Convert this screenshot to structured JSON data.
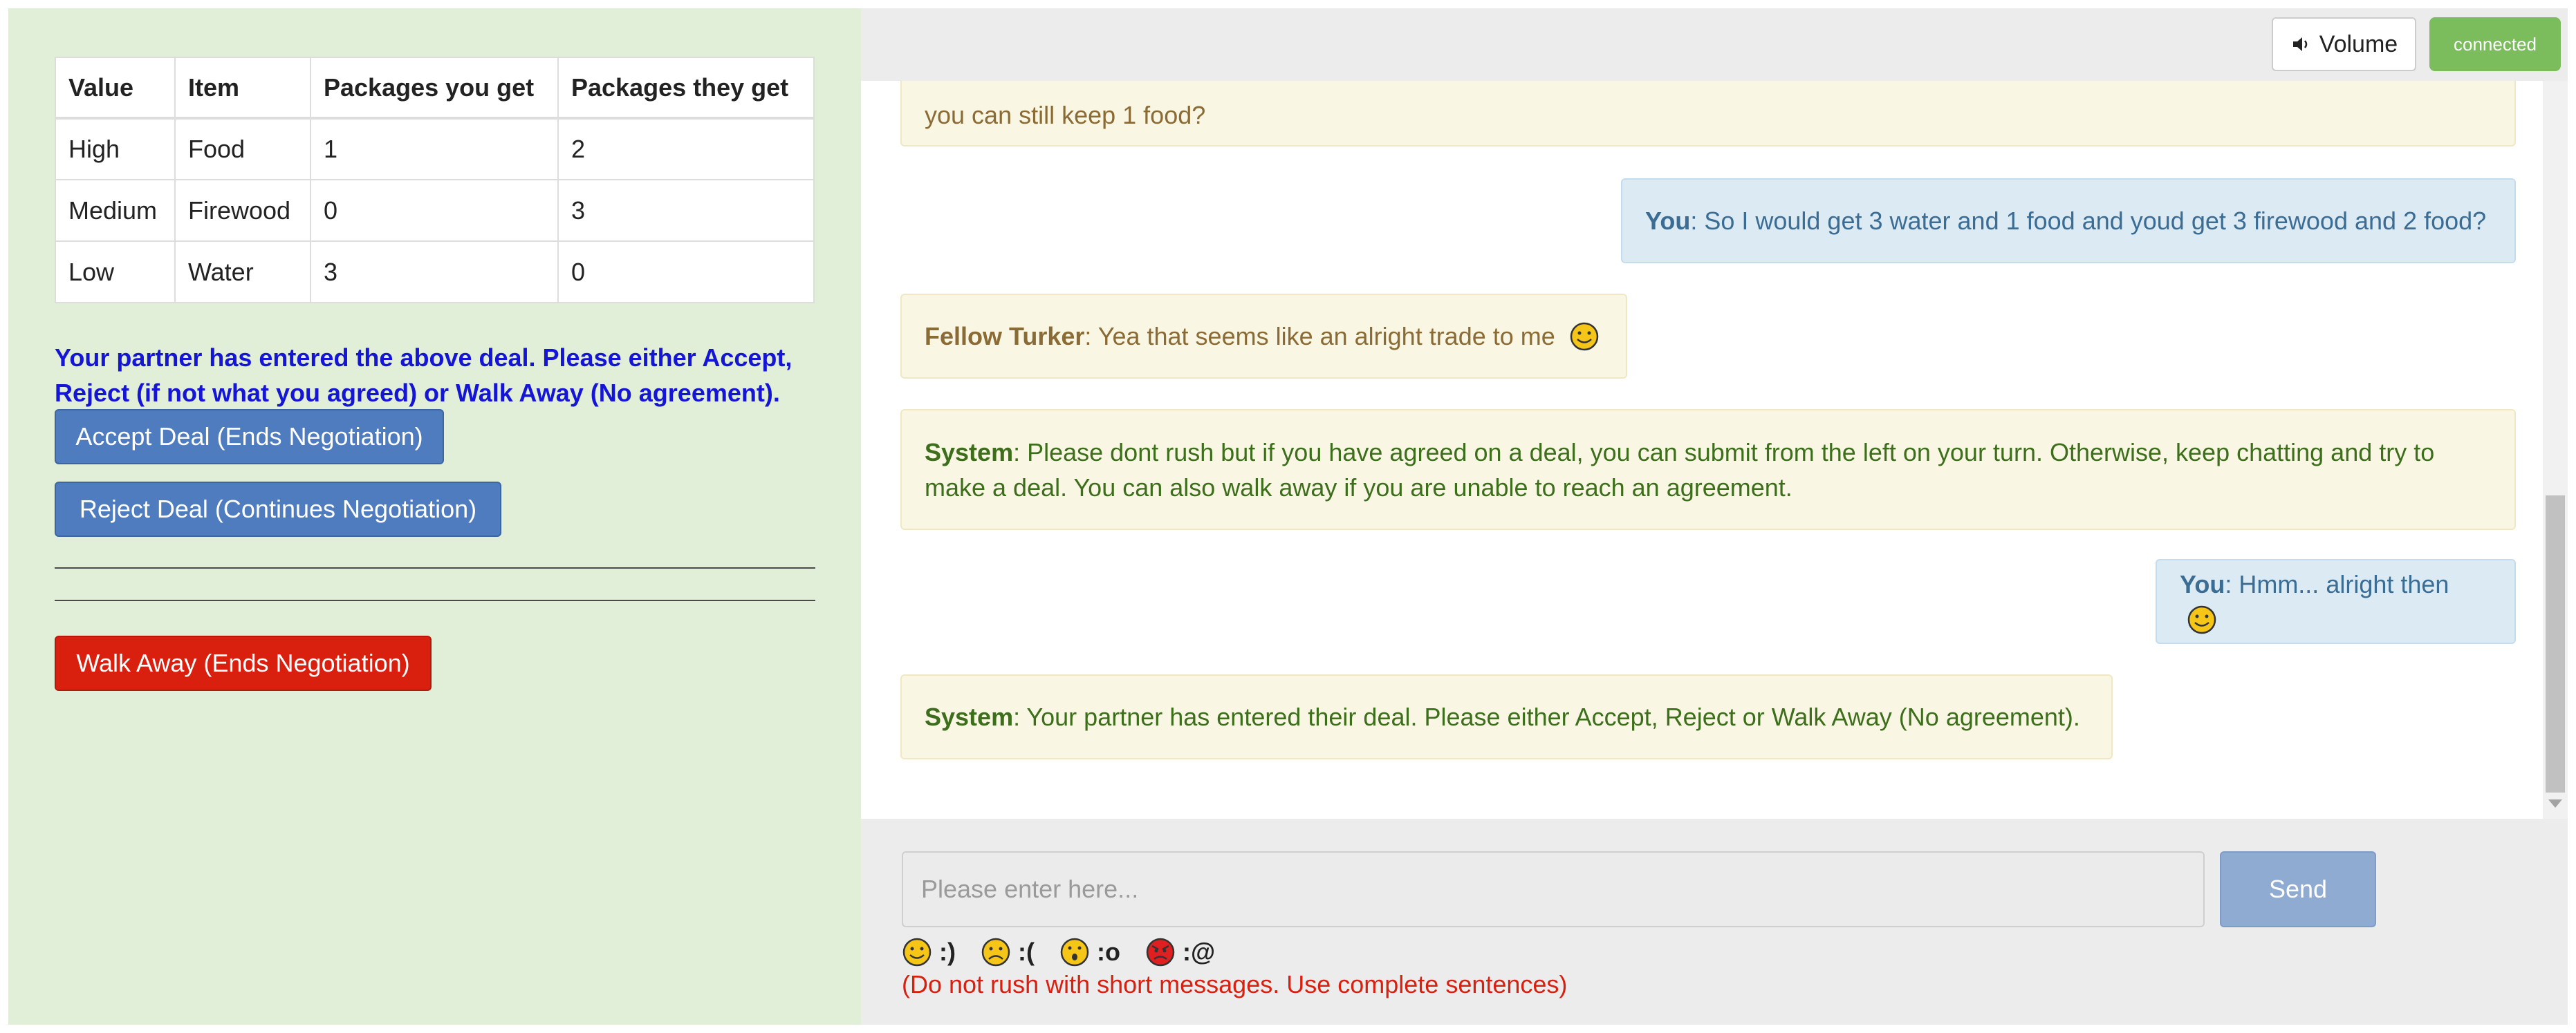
{
  "deal_table": {
    "headers": [
      "Value",
      "Item",
      "Packages you get",
      "Packages they get"
    ],
    "rows": [
      [
        "High",
        "Food",
        "1",
        "2"
      ],
      [
        "Medium",
        "Firewood",
        "0",
        "3"
      ],
      [
        "Low",
        "Water",
        "3",
        "0"
      ]
    ]
  },
  "partner_notice": "Your partner has entered the above deal. Please either Accept, Reject (if not what you agreed) or Walk Away (No agreement).",
  "buttons": {
    "accept": "Accept Deal (Ends Negotiation)",
    "reject": "Reject Deal (Continues Negotiation)",
    "walk_away": "Walk Away (Ends Negotiation)"
  },
  "top_bar": {
    "volume_label": "Volume",
    "volume_icon": "speaker-icon",
    "status": "connected"
  },
  "messages": [
    {
      "speaker": "",
      "text": "you can still keep 1 food?",
      "type": "partner"
    },
    {
      "speaker": "You",
      "text": ": So I would get 3 water and 1 food and youd get 3 firewood and 2 food?",
      "type": "you"
    },
    {
      "speaker": "Fellow Turker",
      "text": ": Yea that seems like an alright trade to me",
      "type": "partner",
      "emoji": "smiley-icon"
    },
    {
      "speaker": "System",
      "text": ": Please dont rush but if you have agreed on a deal, you can submit from the left on your turn. Otherwise, keep chatting and try to make a deal. You can also walk away if you are unable to reach an agreement.",
      "type": "system"
    },
    {
      "speaker": "You",
      "text": ": Hmm... alright then",
      "type": "you",
      "emoji": "smiley-icon"
    },
    {
      "speaker": "System",
      "text": ": Your partner has entered their deal. Please either Accept, Reject or Walk Away (No agreement).",
      "type": "system"
    }
  ],
  "input": {
    "placeholder": "Please enter here...",
    "send_label": "Send"
  },
  "emoji_shortcuts": [
    {
      "icon": "smile-emoji-icon",
      "code": ":)"
    },
    {
      "icon": "frown-emoji-icon",
      "code": ":("
    },
    {
      "icon": "surprised-emoji-icon",
      "code": ":o"
    },
    {
      "icon": "angry-emoji-icon",
      "code": ":@"
    }
  ],
  "hint": "(Do not rush with short messages. Use complete sentences)",
  "colors": {
    "left_panel_bg": "#e1efd8",
    "primary_button": "#4f7cbf",
    "danger_button": "#d9200f",
    "notice_text": "#1515d6",
    "connected_badge": "#7bbd5d",
    "send_button": "#8fabd2"
  }
}
